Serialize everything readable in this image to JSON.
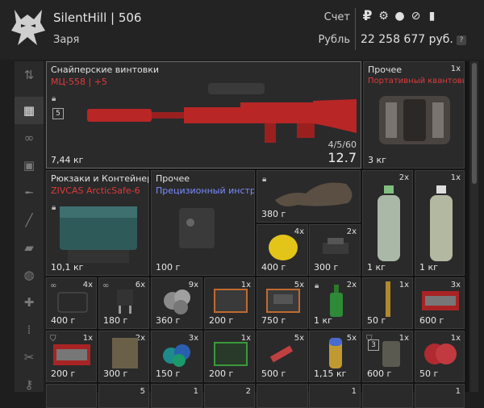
{
  "header": {
    "player_name": "SilentHill | 506",
    "clan": "Заря",
    "account_label": "Счет",
    "currency_label": "Рубль",
    "balance": "22 258 677 руб.",
    "help_label": "?",
    "currency_icons": [
      "ruble-icon",
      "gear-coin-icon",
      "bitcoin-icon",
      "token-icon",
      "card-icon"
    ]
  },
  "sidebar": {
    "items": [
      "sort-icon",
      "grid-icon",
      "link-icon",
      "backpack-icon",
      "rifle-icon",
      "knife-icon",
      "tools-icon",
      "grenade-icon",
      "medkit-icon",
      "ammo-icon",
      "scissors-icon",
      "key-icon"
    ]
  },
  "items": {
    "sniper": {
      "category": "Снайперские винтовки",
      "name": "МЦ-558 | +5",
      "weight": "7,44 кг",
      "ammo": "4/5/60",
      "accuracy": "12.7",
      "badge": "5"
    },
    "misc1": {
      "category": "Прочее",
      "qty": "1x",
      "name": "Портативный квантовы..",
      "weight": "3 кг"
    },
    "backpack": {
      "category": "Рюкзаки и Контейнеры",
      "name": "ZIVCAS ArcticSafe-6",
      "weight": "10,1 кг"
    },
    "precision": {
      "category": "Прочее",
      "name": "Прецизионный инструм..",
      "weight": "100 г"
    },
    "hide": {
      "weight": "380 г"
    },
    "bottle1": {
      "qty": "2x",
      "weight": "1 кг"
    },
    "bottle2": {
      "qty": "1x",
      "weight": "1 кг"
    },
    "lemon": {
      "qty": "4x",
      "weight": "400 г"
    },
    "scrap": {
      "qty": "2x",
      "weight": "300 г"
    },
    "r3": [
      {
        "qty": "4x",
        "weight": "400 г"
      },
      {
        "qty": "6x",
        "weight": "180 г"
      },
      {
        "qty": "9x",
        "weight": "360 г"
      },
      {
        "qty": "1x",
        "weight": "200 г"
      },
      {
        "qty": "5x",
        "weight": "750 г"
      },
      {
        "qty": "2x",
        "weight": "1 кг"
      },
      {
        "qty": "1x",
        "weight": "50 г"
      },
      {
        "qty": "3x",
        "weight": "600 г"
      }
    ],
    "r4": [
      {
        "qty": "1x",
        "weight": "200 г"
      },
      {
        "qty": "2x",
        "weight": "300 г"
      },
      {
        "qty": "3x",
        "weight": "150 г"
      },
      {
        "qty": "1x",
        "weight": "200 г"
      },
      {
        "qty": "5x",
        "weight": "500 г"
      },
      {
        "qty": "5x",
        "weight": "1,15 кг"
      },
      {
        "qty": "1x",
        "weight": "600 г",
        "badge": "3"
      },
      {
        "qty": "1x",
        "weight": "50 г"
      }
    ],
    "r5_qty": [
      "",
      "5",
      "1",
      "2",
      "",
      "1",
      "",
      "1"
    ]
  }
}
